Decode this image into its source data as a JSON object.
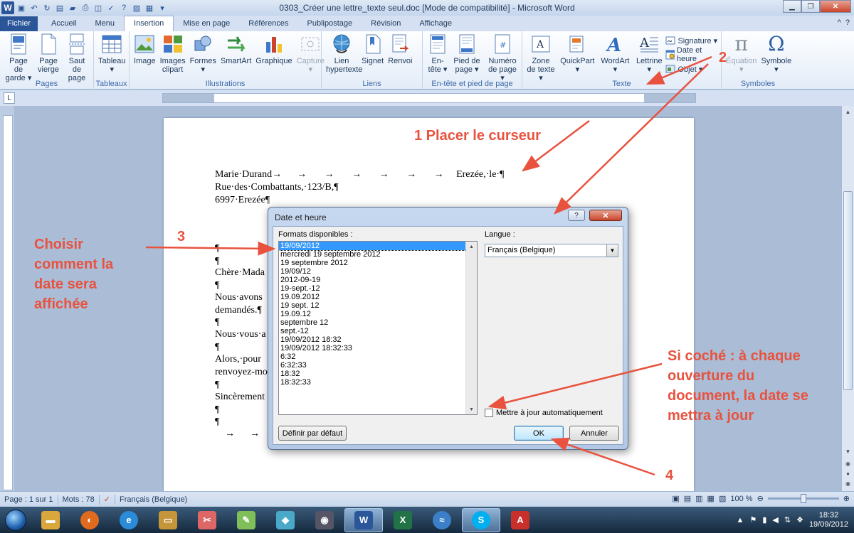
{
  "window": {
    "title": "0303_Créer une lettre_texte seul.doc [Mode de compatibilité]  -  Microsoft Word",
    "app_icon": "W"
  },
  "tabs": [
    "Fichier",
    "Accueil",
    "Menu",
    "Insertion",
    "Mise en page",
    "Références",
    "Publipostage",
    "Révision",
    "Affichage"
  ],
  "ribbon": {
    "pages": {
      "name": "Pages",
      "items": [
        {
          "label": "Page de garde ▾",
          "icon": "cover-page-icon"
        },
        {
          "label": "Page vierge",
          "icon": "blank-page-icon"
        },
        {
          "label": "Saut de page",
          "icon": "page-break-icon"
        }
      ]
    },
    "tables": {
      "name": "Tableaux",
      "items": [
        {
          "label": "Tableau ▾",
          "icon": "table-icon"
        }
      ]
    },
    "illustrations": {
      "name": "Illustrations",
      "items": [
        {
          "label": "Image",
          "icon": "image-icon"
        },
        {
          "label": "Images clipart",
          "icon": "clipart-icon"
        },
        {
          "label": "Formes ▾",
          "icon": "shapes-icon"
        },
        {
          "label": "SmartArt",
          "icon": "smartart-icon"
        },
        {
          "label": "Graphique",
          "icon": "chart-icon"
        },
        {
          "label": "Capture ▾",
          "icon": "screenshot-icon"
        }
      ]
    },
    "links": {
      "name": "Liens",
      "items": [
        {
          "label": "Lien hypertexte",
          "icon": "hyperlink-icon"
        },
        {
          "label": "Signet",
          "icon": "bookmark-icon"
        },
        {
          "label": "Renvoi",
          "icon": "cross-reference-icon"
        }
      ]
    },
    "header_footer": {
      "name": "En-tête et pied de page",
      "items": [
        {
          "label": "En-tête ▾",
          "icon": "header-icon"
        },
        {
          "label": "Pied de page ▾",
          "icon": "footer-icon"
        },
        {
          "label": "Numéro de page ▾",
          "icon": "page-number-icon"
        }
      ]
    },
    "text": {
      "name": "Texte",
      "items": [
        {
          "label": "Zone de texte ▾",
          "icon": "text-box-icon"
        },
        {
          "label": "QuickPart ▾",
          "icon": "quickpart-icon"
        },
        {
          "label": "WordArt ▾",
          "icon": "wordart-icon"
        },
        {
          "label": "Lettrine ▾",
          "icon": "drop-cap-icon"
        }
      ],
      "small": [
        {
          "label": "Signature ▾",
          "icon": "signature-icon"
        },
        {
          "label": "Date et heure",
          "icon": "date-time-icon"
        },
        {
          "label": "Objet ▾",
          "icon": "object-icon"
        }
      ]
    },
    "symbols": {
      "name": "Symboles",
      "items": [
        {
          "label": "Équation ▾",
          "icon": "equation-icon"
        },
        {
          "label": "Symbole ▾",
          "icon": "symbol-icon"
        }
      ]
    }
  },
  "document": {
    "lines": [
      "Marie·Durand→      →       →       →       →       →       →     Erezée,·le·¶",
      "Rue·des·Combattants,·123/B,¶",
      "6997·Erezée¶",
      "¶",
      "¶",
      "Chère·Mada",
      "¶",
      "Nous·avons",
      "demandés.¶",
      "¶",
      "Nous·vous·a",
      "¶",
      "Alors,·pour",
      "renvoyez-mo",
      "¶",
      "Sincèrement",
      "¶",
      "¶",
      "    →      →"
    ]
  },
  "dialog": {
    "title": "Date et heure",
    "help": "?",
    "close": "✕",
    "formats_label": "Formats disponibles :",
    "language_label": "Langue :",
    "language_value": "Français (Belgique)",
    "formats": [
      "19/09/2012",
      "mercredi 19 septembre 2012",
      "19 septembre 2012",
      "19/09/12",
      "2012-09-19",
      "19-sept.-12",
      "19.09.2012",
      "19 sept. 12",
      "19.09.12",
      "septembre 12",
      "sept.-12",
      "19/09/2012 18:32",
      "19/09/2012 18:32:33",
      "6:32",
      "6:32:33",
      "18:32",
      "18:32:33"
    ],
    "selected_index": 0,
    "auto_update_label": "Mettre à jour automatiquement",
    "default_button": "Définir par défaut",
    "ok_button": "OK",
    "cancel_button": "Annuler"
  },
  "statusbar": {
    "page": "Page : 1 sur 1",
    "words": "Mots : 78",
    "language": "Français (Belgique)",
    "zoom": "100 %"
  },
  "taskbar": {
    "time": "18:32",
    "date": "19/09/2012"
  },
  "annotations": {
    "step1": "1 Placer le curseur",
    "step2": "2",
    "step3": "3",
    "step3_text": "Choisir comment la date sera affichée",
    "step4": "4",
    "auto_note": "Si coché : à chaque ouverture du document, la date se mettra à jour",
    "color": "#e8523f"
  }
}
